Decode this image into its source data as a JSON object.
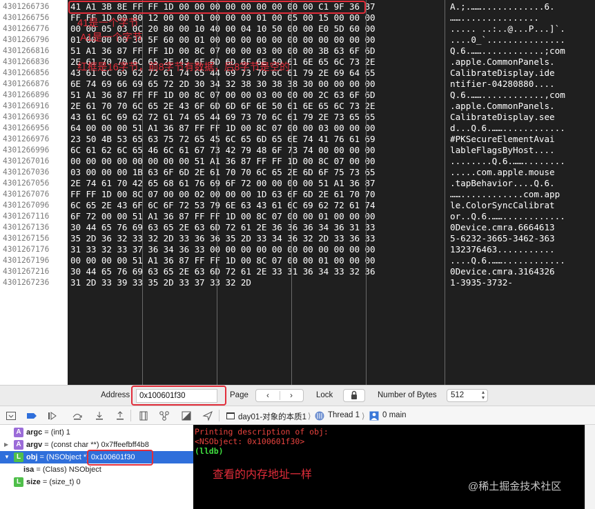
{
  "memory": {
    "addresses": [
      "4301266736",
      "4301266756",
      "4301266776",
      "4301266796",
      "4301266816",
      "4301266836",
      "4301266856",
      "4301266876",
      "4301266896",
      "4301266916",
      "4301266936",
      "4301266956",
      "4301266976",
      "4301266996",
      "4301267016",
      "4301267036",
      "4301267056",
      "4301267076",
      "4301267096",
      "4301267116",
      "4301267136",
      "4301267156",
      "4301267176",
      "4301267196",
      "4301267216",
      "4301267236"
    ],
    "hex_rows": [
      "41 A1 3B 8E FF FF 1D 00 00 00 00 00 00 00 00 00 C1 9F 36 87",
      "FF FF 1D 00 80 12 00 00 01 00 00 00 01 00 05 00 15 00 00 00",
      "00 00 05 03 0C 20 80 00 10 40 00 04 10 50 00 00 E0 5D 60 00",
      "01 00 00 00 30 5F 60 00 01 00 00 00 00 00 00 00 00 00 00 00",
      "51 A1 36 87 FF FF 1D 00 8C 07 00 00 03 00 00 00 3B 63 6F 6D",
      "2E 61 70 70 6C 65 2E 43 6F 6D 6D 6F 6E 50 61 6E 65 6C 73 2E",
      "43 61 6C 69 62 72 61 74 65 44 69 73 70 6C 61 79 2E 69 64 65",
      "6E 74 69 66 69 65 72 2D 30 34 32 38 30 38 38 30 00 00 00 00",
      "51 A1 36 87 FF FF 1D 00 8C 07 00 00 03 00 00 00 2C 63 6F 6D",
      "2E 61 70 70 6C 65 2E 43 6F 6D 6D 6F 6E 50 61 6E 65 6C 73 2E",
      "43 61 6C 69 62 72 61 74 65 44 69 73 70 6C 61 79 2E 73 65 65",
      "64 00 00 00 51 A1 36 87 FF FF 1D 00 8C 07 00 00 03 00 00 00",
      "23 50 4B 53 65 63 75 72 65 45 6C 65 6D 65 6E 74 41 76 61 69",
      "6C 61 62 6C 65 46 6C 61 67 73 42 79 48 6F 73 74 00 00 00 00",
      "00 00 00 00 00 00 00 00 51 A1 36 87 FF FF 1D 00 8C 07 00 00",
      "03 00 00 00 1B 63 6F 6D 2E 61 70 70 6C 65 2E 6D 6F 75 73 65",
      "2E 74 61 70 42 65 68 61 76 69 6F 72 00 00 00 00 51 A1 36 87",
      "FF FF 1D 00 8C 07 00 00 02 00 00 00 1D 63 6F 6D 2E 61 70 70",
      "6C 65 2E 43 6F 6C 6F 72 53 79 6E 63 43 61 6C 69 62 72 61 74",
      "6F 72 00 00 51 A1 36 87 FF FF 1D 00 8C 07 00 00 01 00 00 00",
      "30 44 65 76 69 63 65 2E 63 6D 72 61 2E 36 36 36 34 36 31 33",
      "35 2D 36 32 33 32 2D 33 36 36 35 2D 33 34 36 32 2D 33 36 33",
      "31 33 32 33 37 36 34 36 33 00 00 00 00 00 00 00 00 00 00 00",
      "00 00 00 00 51 A1 36 87 FF FF 1D 00 8C 07 00 00 01 00 00 00",
      "30 44 65 76 69 63 65 2E 63 6D 72 61 2E 33 31 36 34 33 32 36",
      "31 2D 33 39 33 35 2D 33 37 33 32 2D"
    ],
    "ascii_rows": [
      "A.;.……............6.",
      "……...............",
      "..... ..:..@...P...]`.",
      "....0_`...............",
      "Q.6.……............;com",
      ".apple.CommonPanels.",
      "CalibrateDisplay.ide",
      "ntifier-04280880....",
      "Q.6.……............,com",
      ".apple.CommonPanels.",
      "CalibrateDisplay.see",
      "d...Q.6.……............",
      "#PKSecureElementAvai",
      "lableFlagsByHost....",
      "........Q.6.……........",
      ".....com.apple.mouse",
      ".tapBehavior....Q.6.",
      "……............com.app",
      "le.ColorSyncCalibrat",
      "or..Q.6.……............",
      "0Device.cmra.6664613",
      "5-6232-3665-3462-363",
      "132376463...........",
      "....Q.6.……............",
      "0Device.cmra.3164326",
      "1-3935-3732-"
    ],
    "annotations": {
      "line1": "41是一个字节",
      "line2": "A1是一个字节",
      "line3": "红框是16字节，前8字节有数据，后8字节是空的"
    }
  },
  "address_bar": {
    "address_label": "Address",
    "address_value": "0x100601f30",
    "page_label": "Page",
    "lock_label": "Lock",
    "bytes_label": "Number of Bytes",
    "bytes_value": "512"
  },
  "debug_toolbar": {
    "breadcrumb_project": "day01-对象的本质1",
    "breadcrumb_thread": "Thread 1",
    "breadcrumb_frame": "0 main"
  },
  "variables": [
    {
      "badge": "A",
      "name": "argc",
      "value": " = (int) 1"
    },
    {
      "badge": "A",
      "name": "argv",
      "value": " = (const char **) 0x7ffeefbff4b8"
    },
    {
      "badge": "L",
      "name": "obj",
      "value": " = (NSObject *) ",
      "addr": "0x100601f30"
    },
    {
      "badge": "",
      "name": "isa",
      "value": " = (Class) NSObject"
    },
    {
      "badge": "L",
      "name": "size",
      "value": " = (size_t) 0"
    }
  ],
  "console": {
    "line1": "Printing description of obj:",
    "line2": "<NSObject: 0x100601f30>",
    "prompt": "(lldb)",
    "note": "查看的内存地址一样"
  },
  "watermark": "@稀土掘金技术社区",
  "colors": {
    "accent_red": "#e22d3a",
    "selection_blue": "#2f6fdb",
    "badge_purple": "#9b6cd8",
    "badge_green": "#4fbf4a",
    "lldb_green": "#3fdc3f"
  }
}
